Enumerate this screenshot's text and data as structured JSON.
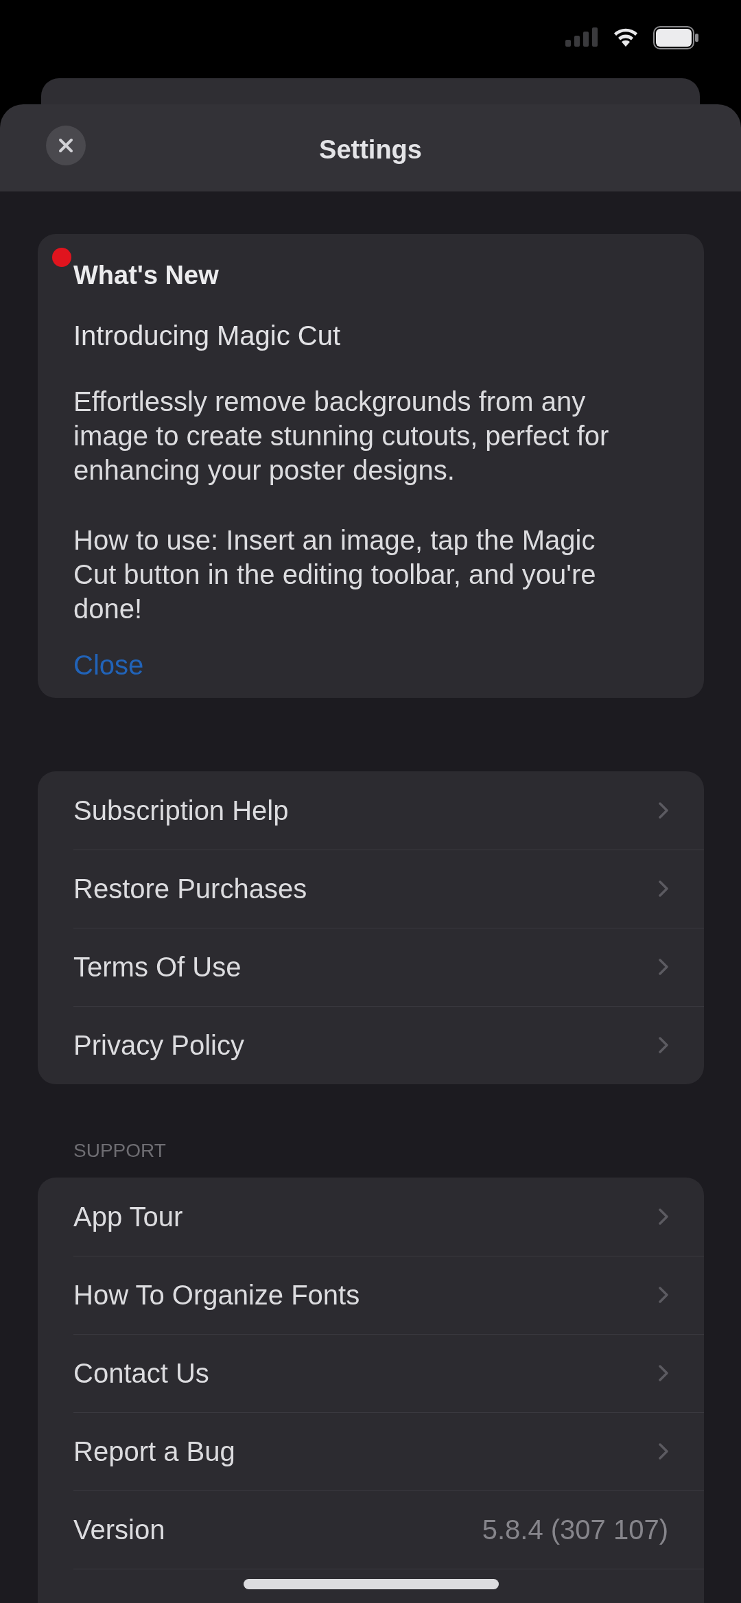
{
  "header": {
    "title": "Settings"
  },
  "whats_new": {
    "title": "What's New",
    "unread": true,
    "headline": "Introducing Magic Cut",
    "paragraphs": [
      "Effortlessly remove backgrounds from any image to create stunning cutouts, perfect for enhancing your poster designs.",
      "How to use: Insert an image, tap the Magic Cut button in the editing toolbar, and you're done!"
    ],
    "close_label": "Close"
  },
  "sections": [
    {
      "items": [
        {
          "kind": "link",
          "label": "Subscription Help"
        },
        {
          "kind": "link",
          "label": "Restore Purchases"
        },
        {
          "kind": "link",
          "label": "Terms Of Use"
        },
        {
          "kind": "link",
          "label": "Privacy Policy"
        }
      ]
    },
    {
      "header": "SUPPORT",
      "items": [
        {
          "kind": "link",
          "label": "App Tour"
        },
        {
          "kind": "link",
          "label": "How To Organize Fonts"
        },
        {
          "kind": "link",
          "label": "Contact Us"
        },
        {
          "kind": "link",
          "label": "Report a Bug"
        },
        {
          "kind": "value",
          "label": "Version",
          "value": "5.8.4 (307 107)"
        }
      ]
    }
  ]
}
